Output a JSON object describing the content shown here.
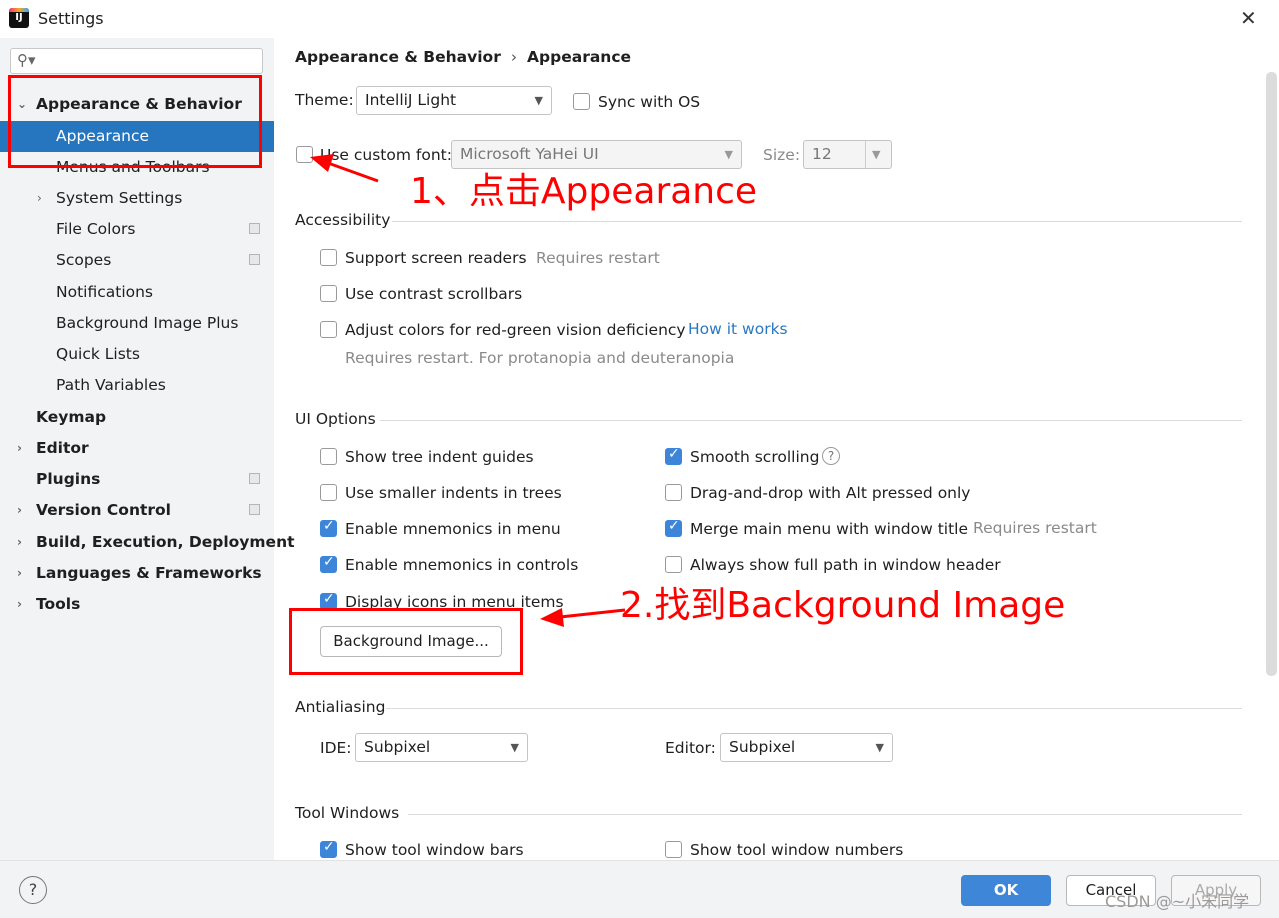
{
  "window": {
    "title": "Settings",
    "close_glyph": "✕",
    "app_icon": "intellij-logo"
  },
  "sidebar": {
    "search_placeholder": "",
    "items": [
      {
        "label": "Appearance & Behavior",
        "bold": true,
        "expanded": true
      },
      {
        "label": "Appearance",
        "selected": true
      },
      {
        "label": "Menus and Toolbars"
      },
      {
        "label": "System Settings"
      },
      {
        "label": "File Colors"
      },
      {
        "label": "Scopes"
      },
      {
        "label": "Notifications"
      },
      {
        "label": "Background Image Plus"
      },
      {
        "label": "Quick Lists"
      },
      {
        "label": "Path Variables"
      },
      {
        "label": "Keymap",
        "bold": true
      },
      {
        "label": "Editor",
        "bold": true
      },
      {
        "label": "Plugins",
        "bold": true
      },
      {
        "label": "Version Control",
        "bold": true
      },
      {
        "label": "Build, Execution, Deployment",
        "bold": true
      },
      {
        "label": "Languages & Frameworks",
        "bold": true
      },
      {
        "label": "Tools",
        "bold": true
      }
    ]
  },
  "breadcrumb": {
    "parent": "Appearance & Behavior",
    "separator": "›",
    "current": "Appearance"
  },
  "theme": {
    "label": "Theme:",
    "value": "IntelliJ Light",
    "sync_label": "Sync with OS",
    "sync_checked": false
  },
  "font": {
    "custom_label": "Use custom font:",
    "custom_checked": false,
    "family": "Microsoft YaHei UI",
    "size_label": "Size:",
    "size": "12"
  },
  "accessibility": {
    "title": "Accessibility",
    "screen_readers": "Support screen readers",
    "screen_readers_note": "Requires restart",
    "contrast_scrollbars": "Use contrast scrollbars",
    "red_green": "Adjust colors for red-green vision deficiency",
    "how_it_works": "How it works",
    "red_green_note": "Requires restart. For protanopia and deuteranopia"
  },
  "ui_options": {
    "title": "UI Options",
    "tree_indent": "Show tree indent guides",
    "smaller_indents": "Use smaller indents in trees",
    "mnemonics_menu": "Enable mnemonics in menu",
    "mnemonics_controls": "Enable mnemonics in controls",
    "display_icons": "Display icons in menu items",
    "smooth_scrolling": "Smooth scrolling",
    "drag_drop_alt": "Drag-and-drop with Alt pressed only",
    "merge_menu": "Merge main menu with window title",
    "merge_note": "Requires restart",
    "full_path": "Always show full path in window header",
    "background_image_button": "Background Image..."
  },
  "antialiasing": {
    "title": "Antialiasing",
    "ide_label": "IDE:",
    "ide_value": "Subpixel",
    "editor_label": "Editor:",
    "editor_value": "Subpixel"
  },
  "tool_windows": {
    "title": "Tool Windows",
    "show_bars": "Show tool window bars",
    "show_numbers": "Show tool window numbers"
  },
  "footer": {
    "ok": "OK",
    "cancel": "Cancel",
    "apply": "Apply",
    "help": "?"
  },
  "annotations": {
    "step1": "1、点击Appearance",
    "step2": "2.找到Background Image"
  },
  "watermark": "CSDN @~小宋同学",
  "colors": {
    "selection": "#2675bf",
    "checkbox_on": "#3d85d9",
    "annotation": "#ff0000",
    "primary_button": "#3e86d7"
  }
}
